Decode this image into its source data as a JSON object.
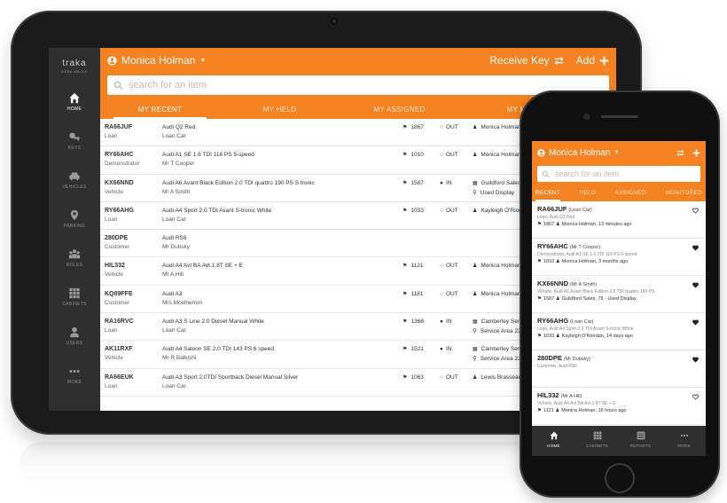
{
  "colors": {
    "accent": "#f58220",
    "sidebar": "#2f2f2f"
  },
  "tablet": {
    "brand": {
      "name": "traka",
      "sub": "ASSA ABLOY"
    },
    "sidebar": [
      {
        "label": "HOME",
        "icon": "home-icon"
      },
      {
        "label": "KEYS",
        "icon": "key-icon"
      },
      {
        "label": "VEHICLES",
        "icon": "car-icon"
      },
      {
        "label": "PARKING",
        "icon": "location-pin-icon"
      },
      {
        "label": "ROLES",
        "icon": "group-icon"
      },
      {
        "label": "CABINETS",
        "icon": "grid-icon"
      },
      {
        "label": "USERS",
        "icon": "user-icon"
      },
      {
        "label": "MORE",
        "icon": "more-icon"
      }
    ],
    "header": {
      "user": "Monica Holman",
      "receive_key": "Receive Key",
      "add": "Add"
    },
    "search": {
      "placeholder": "search for an item"
    },
    "tabs": [
      "MY RECENT",
      "MY HELD",
      "MY ASSIGNED",
      "MY MC"
    ],
    "rows": [
      {
        "reg": "RA66JUF",
        "type": "Loan",
        "desc": "Audi Q2 Red",
        "who": "Loan Car",
        "tag": "1867",
        "status": "OUT",
        "status_icon": "circle-outline-icon",
        "loc": "Monica Holman,",
        "loc2": "",
        "loc_icon": "person-icon"
      },
      {
        "reg": "RY66AHC",
        "type": "Demonstrator",
        "desc": "Audi A1 SE 1.6 TDI 116 PS 5-speed",
        "who": "Mr T Cooper",
        "tag": "1010",
        "status": "OUT",
        "status_icon": "circle-outline-icon",
        "loc": "Monica Holman,",
        "loc2": "",
        "loc_icon": "person-icon"
      },
      {
        "reg": "KX66NND",
        "type": "Vehicle",
        "desc": "Audi A6 Avant Black Edition 2.0 TDI quattro 190 PS S tronic",
        "who": "Mr A Smith",
        "tag": "1587",
        "status": "IN",
        "status_icon": "circle-filled-icon",
        "loc": "Guildford Sales,",
        "loc2": "Used Display",
        "loc_icon": "cabinet-icon"
      },
      {
        "reg": "RY66AHG",
        "type": "Loan",
        "desc": "Audi A4 Sport 2.0 TDI Avant S-tronic White",
        "who": "Loan Car",
        "tag": "1033",
        "status": "OUT",
        "status_icon": "circle-outline-icon",
        "loc": "Kayleigh O'Riord",
        "loc2": "",
        "loc_icon": "person-icon"
      },
      {
        "reg": "280DPE",
        "type": "Customer",
        "desc": "Audi RS6",
        "who": "Mr Dubsky",
        "tag": "",
        "status": "",
        "status_icon": "",
        "loc": "",
        "loc2": "",
        "loc_icon": ""
      },
      {
        "reg": "HIL332",
        "type": "Vehicle",
        "desc": "Audi A4 Avt BA Avt.1.8T SE + E",
        "who": "Mr A Hill",
        "tag": "1121",
        "status": "OUT",
        "status_icon": "circle-outline-icon",
        "loc": "Monica Holman,",
        "loc2": "",
        "loc_icon": "person-icon"
      },
      {
        "reg": "KQ09FFE",
        "type": "Customer",
        "desc": "Audi A3",
        "who": "Mrs Mcelherron",
        "tag": "1181",
        "status": "OUT",
        "status_icon": "circle-outline-icon",
        "loc": "Monica Holman,",
        "loc2": "",
        "loc_icon": "person-icon"
      },
      {
        "reg": "RA16RVC",
        "type": "Loan",
        "desc": "Audi A3 S Line 2.0 Diesel Manual White",
        "who": "Loan Car",
        "tag": "1368",
        "status": "IN",
        "status_icon": "circle-filled-icon",
        "loc": "Camberley Servi",
        "loc2": "Service Area 22",
        "loc_icon": "cabinet-icon"
      },
      {
        "reg": "AK11RXF",
        "type": "Vehicle",
        "desc": "Audi A4 Saloon SE 2.0 TDI 143 PS 6 speed",
        "who": "Mr R Balkishi",
        "tag": "1521",
        "status": "IN",
        "status_icon": "circle-filled-icon",
        "loc": "Camberley Serv",
        "loc2": "Service Area 22",
        "loc_icon": "cabinet-icon"
      },
      {
        "reg": "RA66EUK",
        "type": "Loan",
        "desc": "Audi A3 Sport 2.0TDI Sportback Diesel Manual Silver",
        "who": "Loan Car",
        "tag": "1063",
        "status": "OUT",
        "status_icon": "circle-outline-icon",
        "loc": "Lewis Brasseaux",
        "loc2": "",
        "loc_icon": "person-icon"
      }
    ]
  },
  "phone": {
    "header": {
      "user": "Monica Holman"
    },
    "search": {
      "placeholder": "search for an item"
    },
    "tabs": [
      "RECENT",
      "HELD",
      "ASSIGNED",
      "MONITORED"
    ],
    "items": [
      {
        "reg": "RA66JUF",
        "owner": "(Loan Car)",
        "sub": "Loan, Audi Q2 Red",
        "tag": "1867",
        "detail": "Monica Holman, 13 minutes ago",
        "fav": false
      },
      {
        "reg": "RY66AHC",
        "owner": "(Mr T Cooper)",
        "sub": "Demonstrator, Audi A1 SE 1.6 TDI 116 PS 5-speed",
        "tag": "1010",
        "detail": "Monica Holman, 3 months ago",
        "fav": true
      },
      {
        "reg": "KX66NND",
        "owner": "(Mr A Smith)",
        "sub": "Vehicle, Audi A6 Avant Black Edition 2.0 TDI quattro 190 PS",
        "tag": "1587",
        "detail": "Guildford Sales, 79 · Used Display",
        "fav": true
      },
      {
        "reg": "RY66AHG",
        "owner": "(Loan Car)",
        "sub": "Loan, Audi A4 Sport 2.0 TDI Avant S-tronic White",
        "tag": "1033",
        "detail": "Kayleigh O'Riordan, 14 days ago",
        "fav": true
      },
      {
        "reg": "280DPE",
        "owner": "(Mr Dubsky)",
        "sub": "Customer, Audi RS6",
        "tag": "",
        "detail": "",
        "fav": true
      },
      {
        "reg": "HIL332",
        "owner": "(Mr A Hill)",
        "sub": "Vehicle, Audi A4 Avt BA Avt.1.8T SE + E",
        "tag": "1121",
        "detail": "Monica Holman, 16 hours ago",
        "fav": false
      }
    ],
    "nav": [
      {
        "label": "HOME",
        "icon": "home-icon"
      },
      {
        "label": "CABINETS",
        "icon": "grid-icon"
      },
      {
        "label": "REPORTS",
        "icon": "reports-icon"
      },
      {
        "label": "MORE",
        "icon": "more-icon"
      }
    ]
  }
}
